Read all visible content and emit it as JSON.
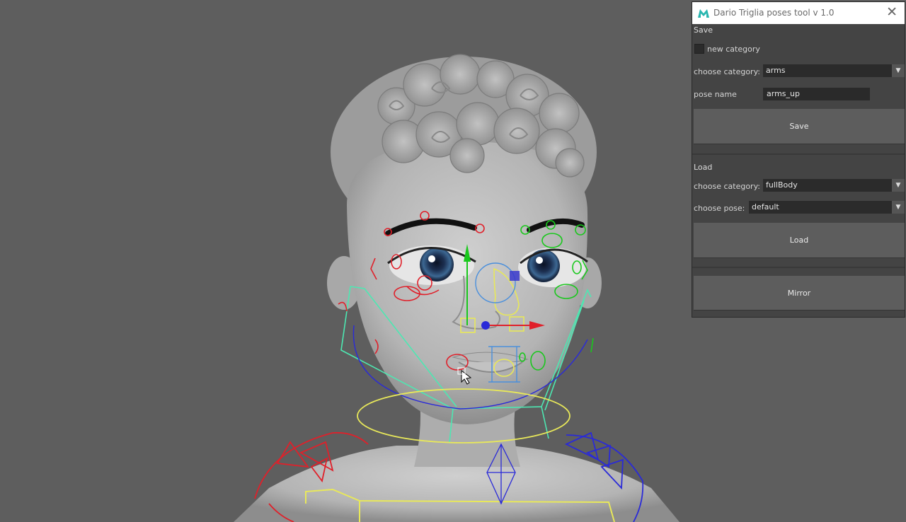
{
  "window": {
    "title": "Dario Triglia poses tool v 1.0",
    "close_glyph": "✕",
    "app_icon": "maya-icon"
  },
  "save_section": {
    "header": "Save",
    "new_category_label": "new category",
    "new_category_checked": false,
    "choose_category_label": "choose category:",
    "category_value": "arms",
    "pose_name_label": "pose name",
    "pose_name_value": "arms_up",
    "save_button": "Save"
  },
  "load_section": {
    "header": "Load",
    "choose_category_label": "choose category:",
    "category_value": "fullBody",
    "choose_pose_label": "choose pose:",
    "pose_value": "default",
    "load_button": "Load"
  },
  "mirror_button": "Mirror",
  "dropdown_arrow": "▼",
  "colors": {
    "viewport_bg": "#5e5e5e",
    "panel_bg": "#444444",
    "field_bg": "#2b2b2b",
    "button_bg": "#5d5d5d",
    "rig_left": "#e0202a",
    "rig_right": "#19c81c",
    "rig_center": "#e8e85a",
    "rig_cyan": "#4de8b2",
    "rig_blue": "#2a2ad8"
  }
}
